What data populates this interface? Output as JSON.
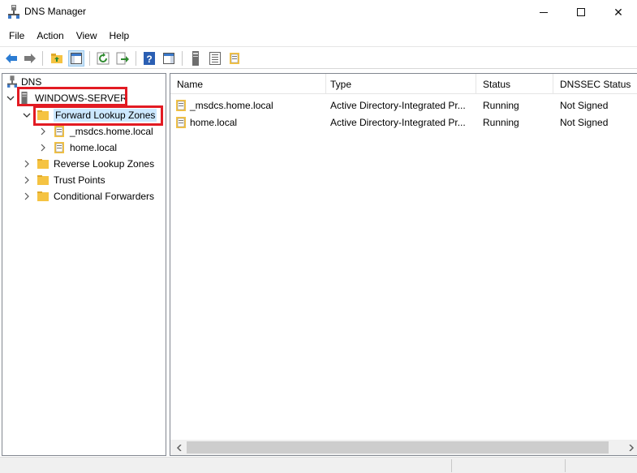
{
  "window": {
    "title": "DNS Manager",
    "icon": "dns-server-icon",
    "controls": {
      "minimize": "minimize-icon",
      "maximize": "maximize-icon",
      "close": "✕"
    }
  },
  "menu": [
    "File",
    "Action",
    "View",
    "Help"
  ],
  "toolbar": {
    "buttons": [
      "back-arrow-icon",
      "forward-arrow-icon",
      "up-folder-icon",
      "show-hide-tree-icon",
      "refresh-icon",
      "export-list-icon",
      "help-icon",
      "properties-pane-icon",
      "server-icon",
      "list-icon",
      "zone-icon"
    ],
    "pressed": "show-hide-tree-icon"
  },
  "tree": {
    "root": {
      "label": "DNS",
      "icon": "dns-icon"
    },
    "server": {
      "label": "WINDOWS-SERVER",
      "icon": "server-icon",
      "expanded": true
    },
    "items": [
      {
        "label": "Forward Lookup Zones",
        "icon": "folder-icon",
        "expanded": true,
        "selected": true
      },
      {
        "label": "_msdcs.home.local",
        "icon": "zone-icon",
        "expanded": false
      },
      {
        "label": "home.local",
        "icon": "zone-icon",
        "expanded": false
      },
      {
        "label": "Reverse Lookup Zones",
        "icon": "folder-icon",
        "expanded": false
      },
      {
        "label": "Trust Points",
        "icon": "folder-icon",
        "expanded": false
      },
      {
        "label": "Conditional Forwarders",
        "icon": "folder-icon",
        "expanded": false
      }
    ]
  },
  "list": {
    "columns": [
      "Name",
      "Type",
      "Status",
      "DNSSEC Status"
    ],
    "rows": [
      {
        "name": "_msdcs.home.local",
        "type": "Active Directory-Integrated Pr...",
        "status": "Running",
        "dnssec": "Not Signed"
      },
      {
        "name": "home.local",
        "type": "Active Directory-Integrated Pr...",
        "status": "Running",
        "dnssec": "Not Signed"
      }
    ]
  },
  "colors": {
    "highlight": "#e21b23",
    "selection": "#cce8ff",
    "folder": "#f5c342",
    "accent_blue": "#2b7cd3"
  }
}
